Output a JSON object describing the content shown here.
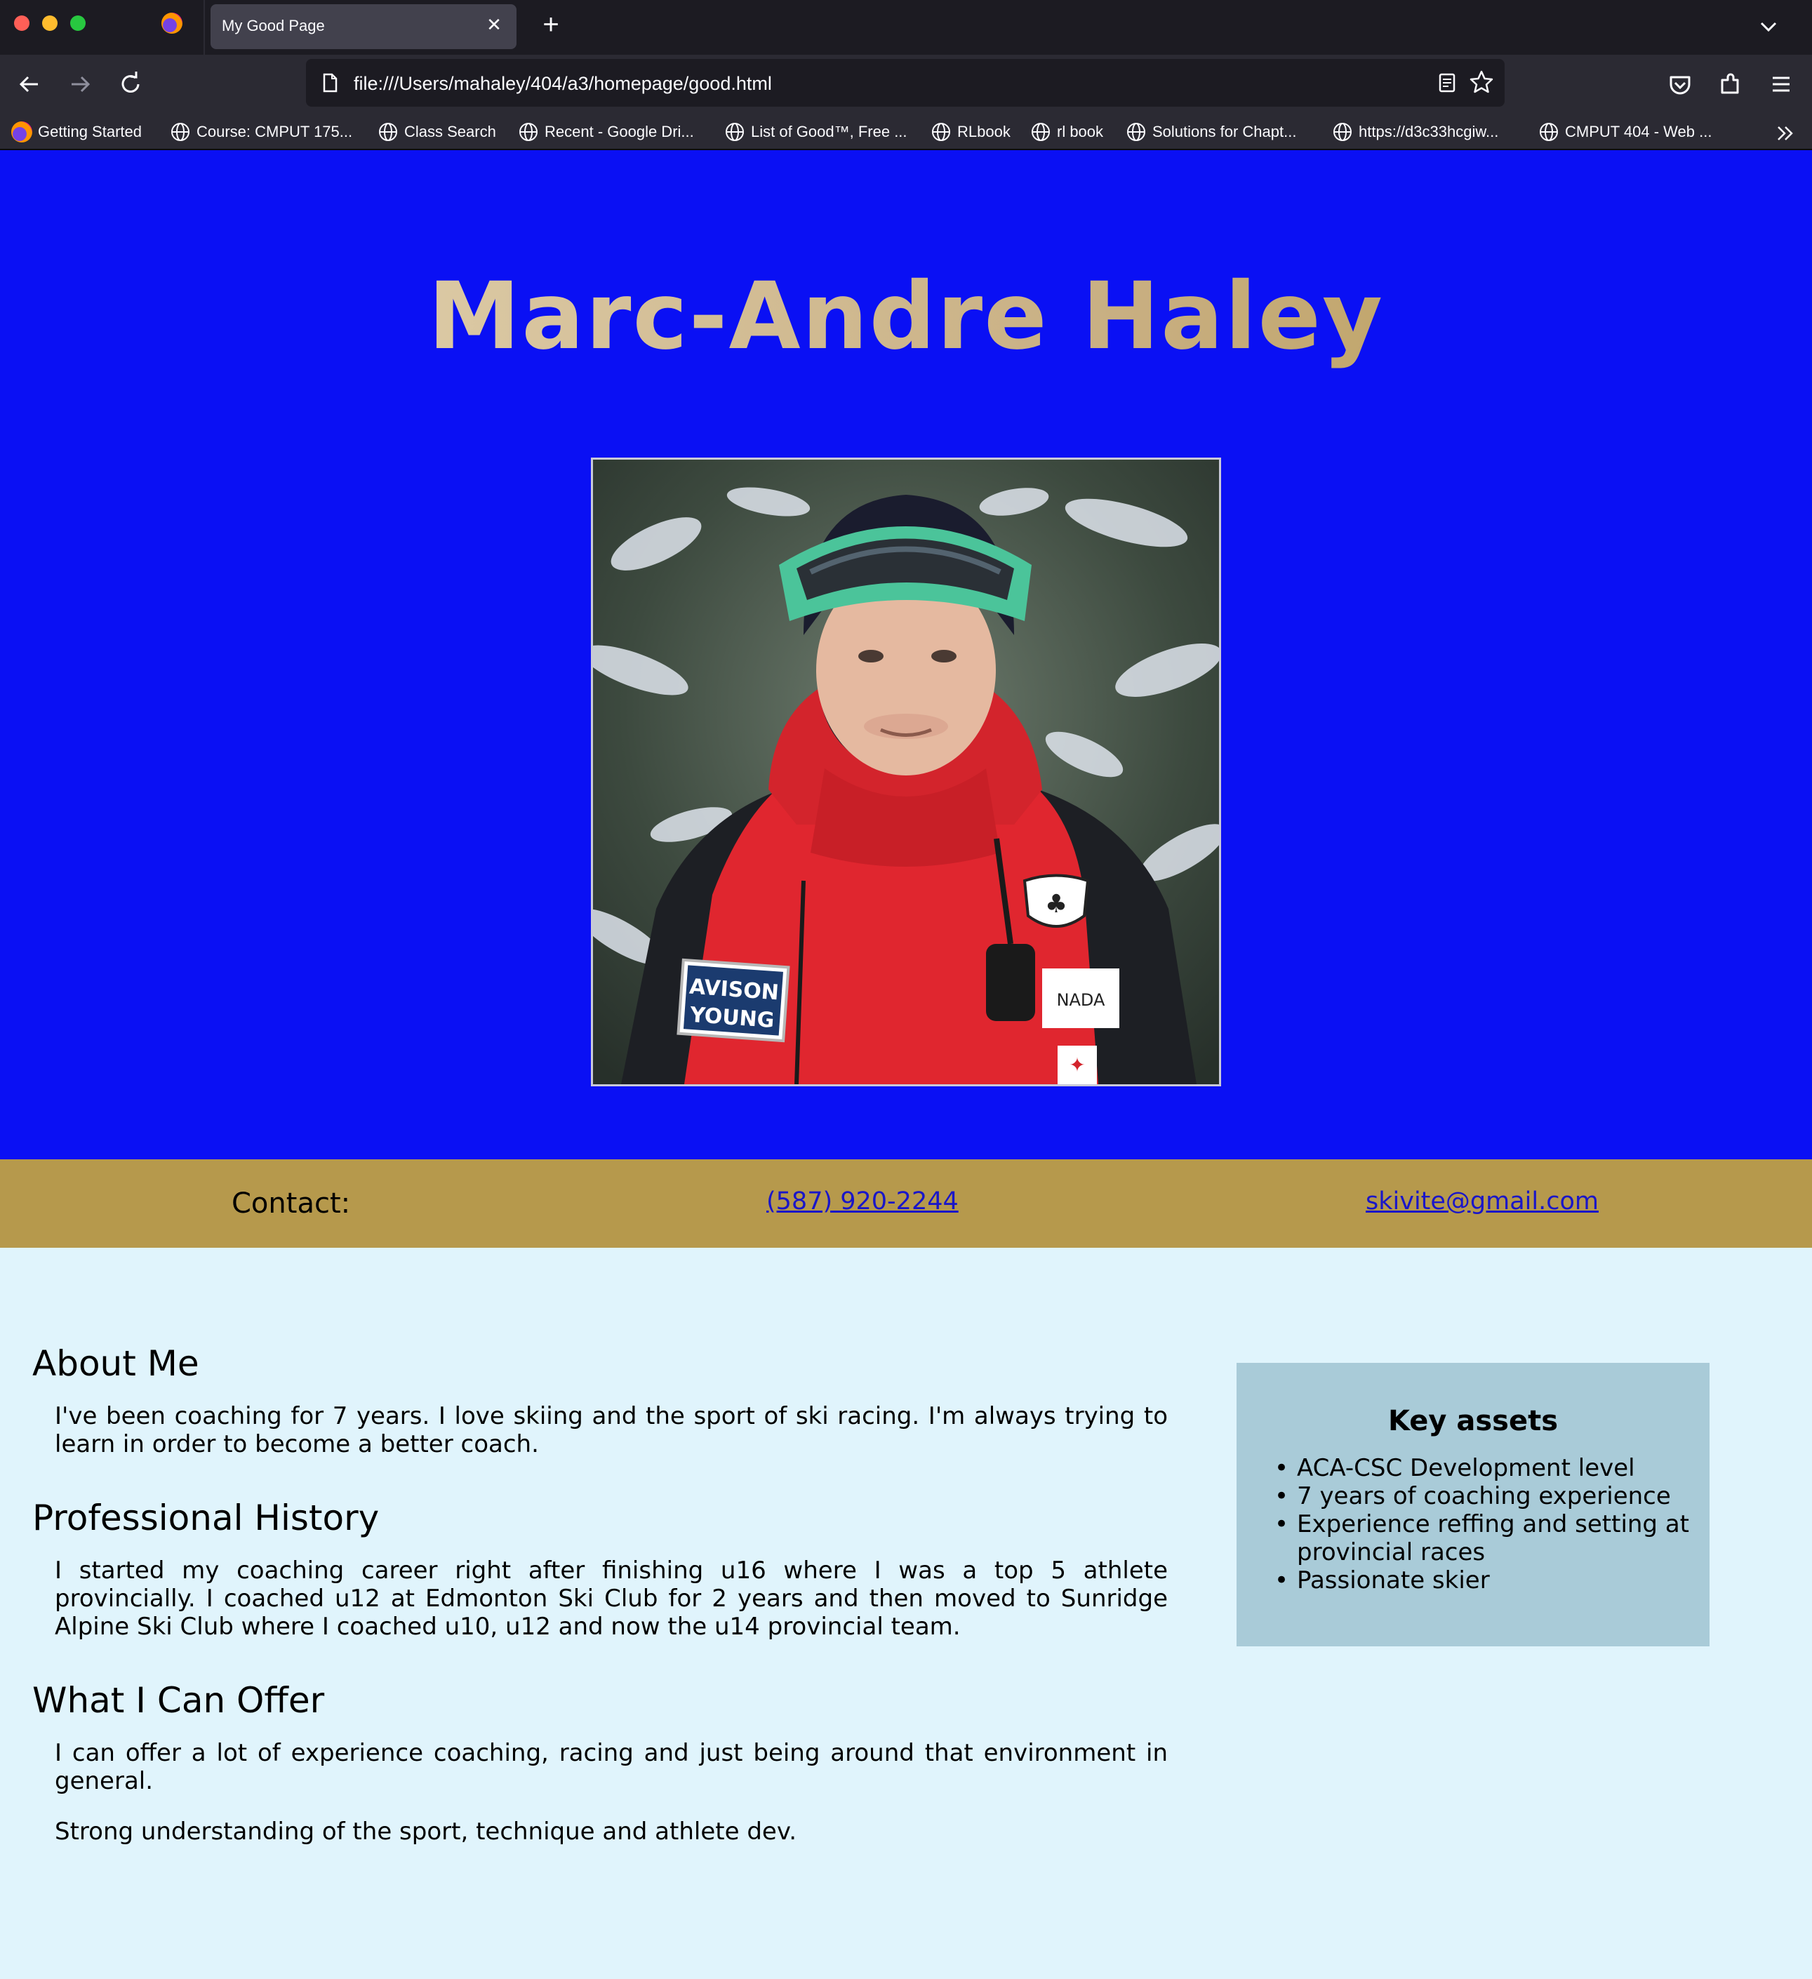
{
  "browser": {
    "tab_title": "My Good Page",
    "url": "file:///Users/mahaley/404/a3/homepage/good.html",
    "bookmarks": [
      "Getting Started",
      "Course: CMPUT 175...",
      "Class Search",
      "Recent - Google Dri...",
      "List of Good™, Free ...",
      "RLbook",
      "rl book",
      "Solutions for Chapt...",
      "https://d3c33hcgiw...",
      "CMPUT 404 - Web ..."
    ]
  },
  "hero": {
    "name": "Marc-Andre Haley",
    "photo_badges": {
      "sponsor_line1": "AVISON",
      "sponsor_line2": "YOUNG",
      "flag_text": "NADA"
    }
  },
  "contact": {
    "label": "Contact:",
    "phone": "(587) 920-2244",
    "email": "skivite@gmail.com"
  },
  "sections": {
    "about_heading": "About Me",
    "about_text": "I've been coaching for 7 years. I love skiing and the sport of ski racing. I'm always trying to learn in order to become a better coach.",
    "history_heading": "Professional History",
    "history_text": "I started my coaching career right after finishing u16 where I was a top 5 athlete provincially. I coached u12 at Edmonton Ski Club for 2 years and then moved to Sunridge Alpine Ski Club where I coached u10, u12 and now the u14 provincial team.",
    "offer_heading": "What I Can Offer",
    "offer_text_1": "I can offer a lot of experience coaching, racing and just being around that environment in general.",
    "offer_text_2": "Strong understanding of the sport, technique and athlete dev."
  },
  "aside": {
    "title": "Key assets",
    "items": [
      "ACA-CSC Development level",
      "7 years of coaching experience",
      "Experience reffing and setting at provincial races",
      "Passionate skier"
    ]
  },
  "colors": {
    "hero_bg": "#0a10f4",
    "name_gold": "#c9b084",
    "contact_bar": "#b6994c",
    "page_bg": "#e0f4fc",
    "aside_bg": "#a9cbd8",
    "link": "#1a16c8"
  }
}
